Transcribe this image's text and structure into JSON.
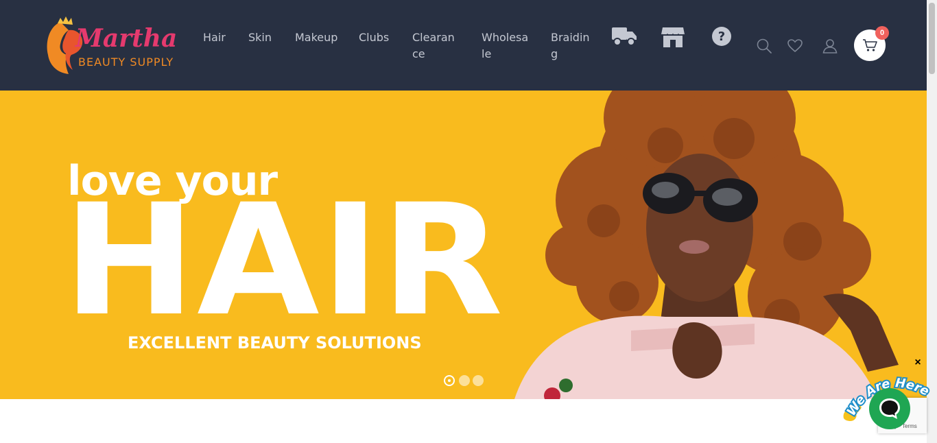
{
  "header": {
    "logo": {
      "text_line1": "Martha's",
      "text_line2": "BEAUTY SUPPLY"
    },
    "nav": [
      {
        "line1": "Hair",
        "line2": ""
      },
      {
        "line1": "Skin",
        "line2": ""
      },
      {
        "line1": "Makeup",
        "line2": ""
      },
      {
        "line1": "Clubs",
        "line2": ""
      },
      {
        "line1": "Clearan",
        "line2": "ce"
      },
      {
        "line1": "Wholesa",
        "line2": "le"
      },
      {
        "line1": "Braidin",
        "line2": "g"
      }
    ],
    "icon_nav": [
      "truck-icon",
      "store-icon",
      "question-icon"
    ],
    "tools": [
      "search-icon",
      "heart-icon",
      "user-icon"
    ],
    "cart": {
      "count": "0",
      "icon": "cart-icon"
    }
  },
  "hero": {
    "line1": "love your",
    "big": "HAIR",
    "subtitle": "EXCELLENT BEAUTY SOLUTIONS",
    "slides": 3,
    "active_slide": 1
  },
  "chat": {
    "badge_text": "We Are Here!",
    "close": "×",
    "recaptcha_text": "cy - Terms"
  },
  "colors": {
    "header_bg": "#283042",
    "hero_bg": "#f9bb1e",
    "nav_text": "#c4c8d2",
    "cart_badge": "#f0615d",
    "chat_green": "#1fa653"
  }
}
